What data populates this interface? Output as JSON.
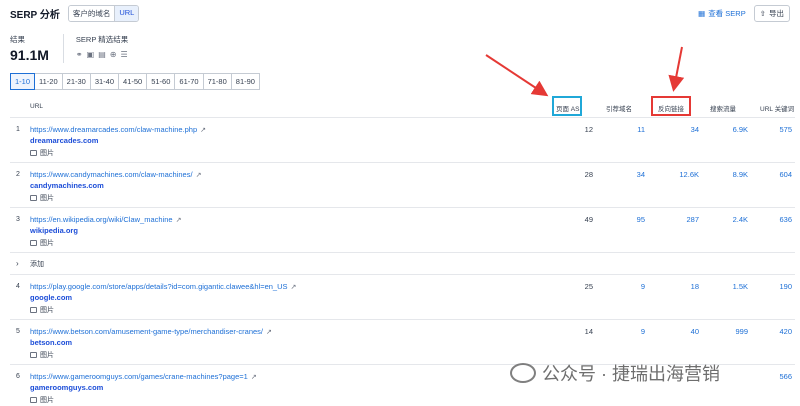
{
  "header": {
    "title": "SERP 分析",
    "toggle": [
      {
        "label": "客户的域名",
        "active": false
      },
      {
        "label": "URL",
        "active": true
      }
    ],
    "view_serp_label": "查看 SERP",
    "export_label": "导出"
  },
  "stats": {
    "results_label": "结果",
    "results_value": "91.1M",
    "features_label": "SERP 精选结果"
  },
  "pagination": [
    "1-10",
    "11-20",
    "21-30",
    "31-40",
    "41-50",
    "51-60",
    "61-70",
    "71-80",
    "81-90"
  ],
  "table": {
    "headers": {
      "url": "URL",
      "page_as": "页面 AS",
      "ref_domains": "引荐域名",
      "backlinks": "反向链接",
      "traffic": "搜索流量",
      "keywords": "URL 关键词"
    },
    "image_label": "图片",
    "add_label": "添加",
    "rows": [
      {
        "rank": "1",
        "url": "https://www.dreamarcades.com/claw-machine.php",
        "domain": "dreamarcades.com",
        "as": "12",
        "ref": "11",
        "backlinks": "34",
        "traffic": "6.9K",
        "keywords": "575"
      },
      {
        "rank": "2",
        "url": "https://www.candymachines.com/claw-machines/",
        "domain": "candymachines.com",
        "as": "28",
        "ref": "34",
        "backlinks": "12.6K",
        "traffic": "8.9K",
        "keywords": "604"
      },
      {
        "rank": "3",
        "url": "https://en.wikipedia.org/wiki/Claw_machine",
        "domain": "wikipedia.org",
        "as": "49",
        "ref": "95",
        "backlinks": "287",
        "traffic": "2.4K",
        "keywords": "636"
      },
      {
        "rank": "4",
        "url": "https://play.google.com/store/apps/details?id=com.gigantic.clawee&hl=en_US",
        "domain": "google.com",
        "as": "25",
        "ref": "9",
        "backlinks": "18",
        "traffic": "1.5K",
        "keywords": "190"
      },
      {
        "rank": "5",
        "url": "https://www.betson.com/amusement-game-type/merchandiser-cranes/",
        "domain": "betson.com",
        "as": "14",
        "ref": "9",
        "backlinks": "40",
        "traffic": "999",
        "keywords": "420"
      },
      {
        "rank": "6",
        "url": "https://www.gameroomguys.com/games/crane-machines?page=1",
        "domain": "gameroomguys.com",
        "as": "",
        "ref": "",
        "backlinks": "",
        "traffic": "",
        "keywords": "566"
      }
    ]
  },
  "watermark": {
    "text": "公众号 · 捷瑞出海营销"
  },
  "colors": {
    "accent": "#1d6fd6",
    "highlight_blue": "#20a8d8",
    "highlight_red": "#e53935"
  }
}
